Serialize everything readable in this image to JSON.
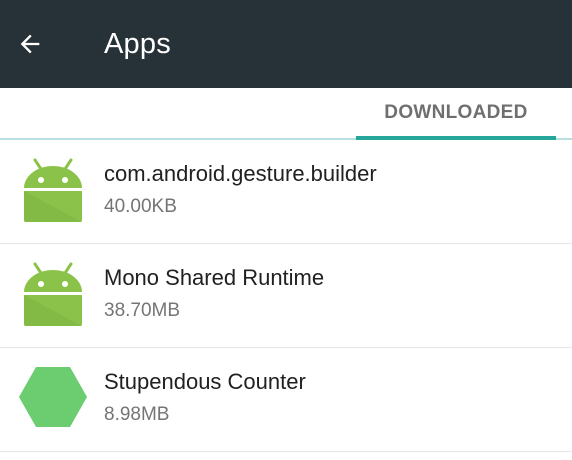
{
  "appbar": {
    "title": "Apps",
    "back_icon": "arrow-back-icon",
    "background": "#263238"
  },
  "tabs": [
    {
      "label": "DOWNLOADED",
      "selected": true
    }
  ],
  "accent": "#26a69a",
  "apps": [
    {
      "name": "com.android.gesture.builder",
      "size": "40.00KB",
      "icon": "android-robot-icon"
    },
    {
      "name": "Mono Shared Runtime",
      "size": "38.70MB",
      "icon": "android-robot-icon"
    },
    {
      "name": "Stupendous Counter",
      "size": "8.98MB",
      "icon": "green-hexagon-icon"
    }
  ]
}
